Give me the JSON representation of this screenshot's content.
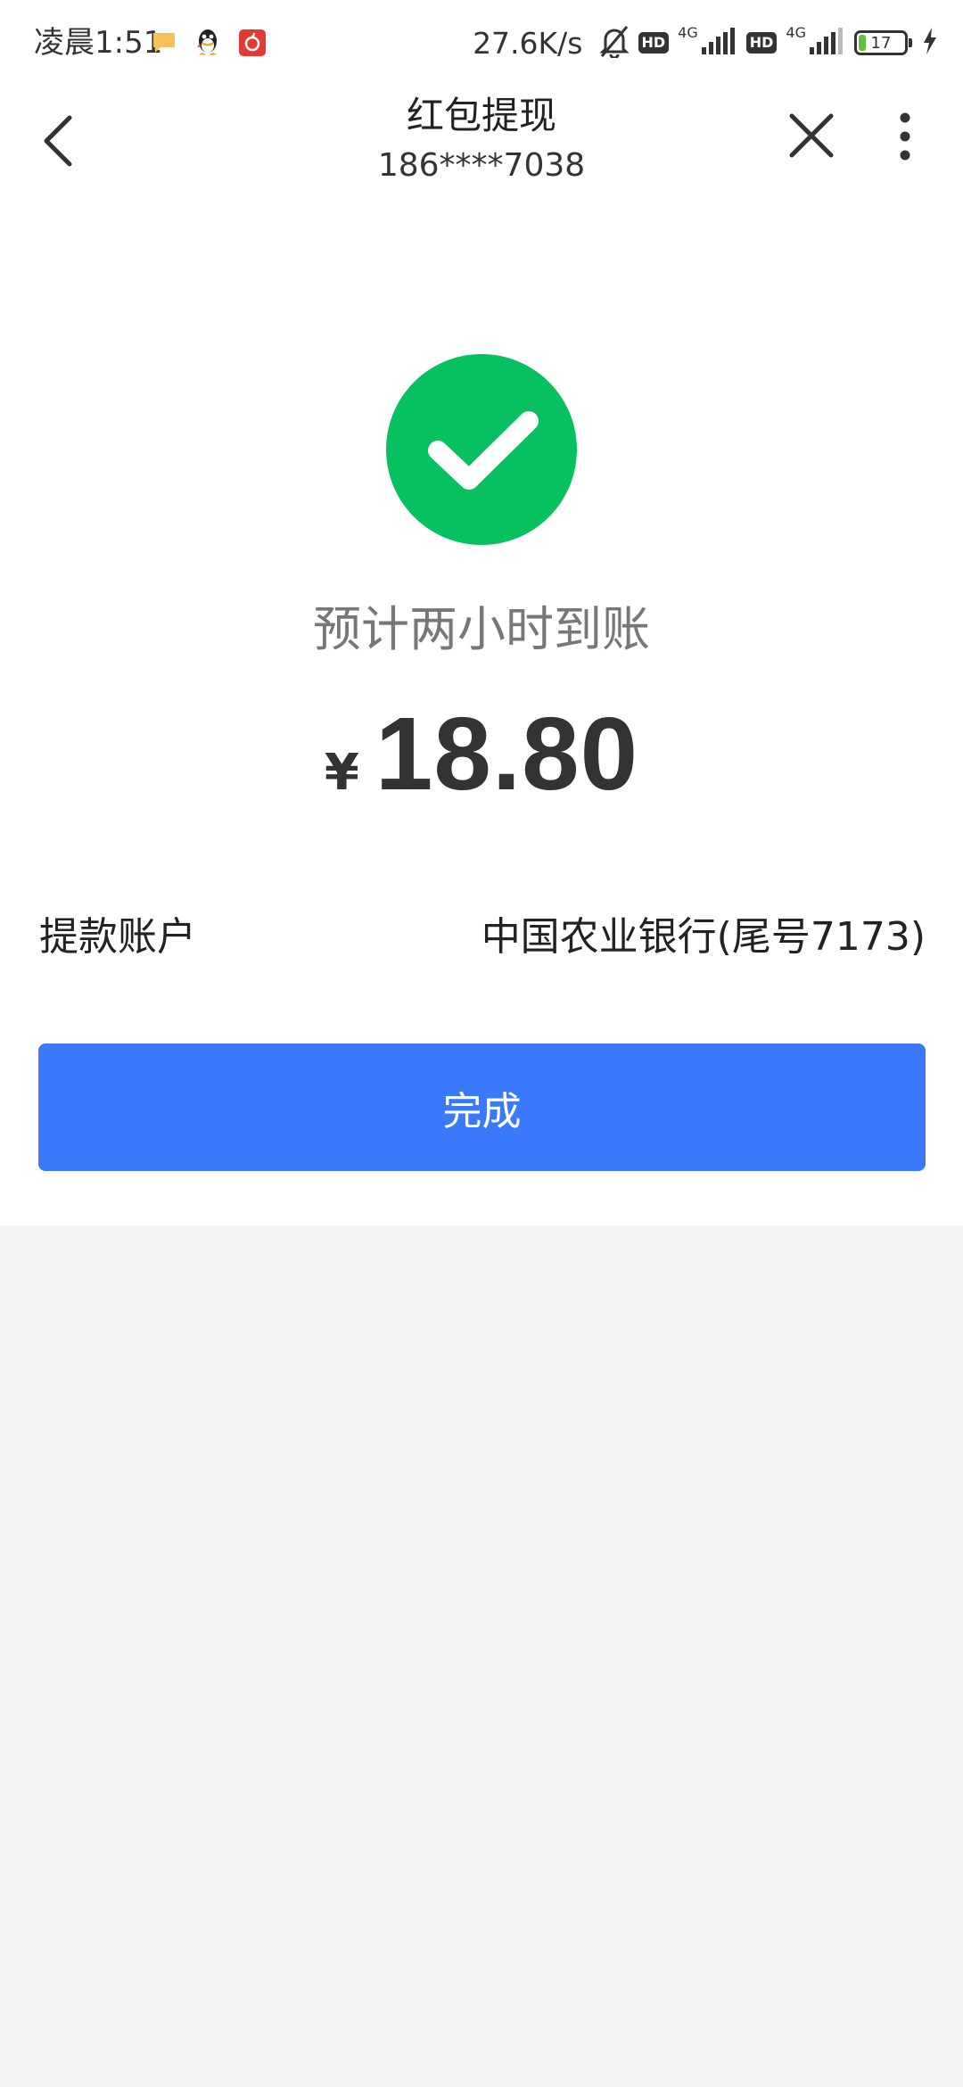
{
  "status_bar": {
    "time": "凌晨1:51",
    "net_speed": "27.6K/s",
    "hd_label": "HD",
    "net_type": "4G",
    "battery": "17"
  },
  "nav": {
    "title": "红包提现",
    "subtitle": "186****7038"
  },
  "result": {
    "eta": "预计两小时到账",
    "currency": "¥",
    "amount": "18.80"
  },
  "account": {
    "label": "提款账户",
    "value": "中国农业银行(尾号7173)"
  },
  "actions": {
    "done_label": "完成"
  },
  "colors": {
    "success": "#07c160",
    "primary_button": "#3a79fc",
    "page_background": "#f2f2f2"
  }
}
